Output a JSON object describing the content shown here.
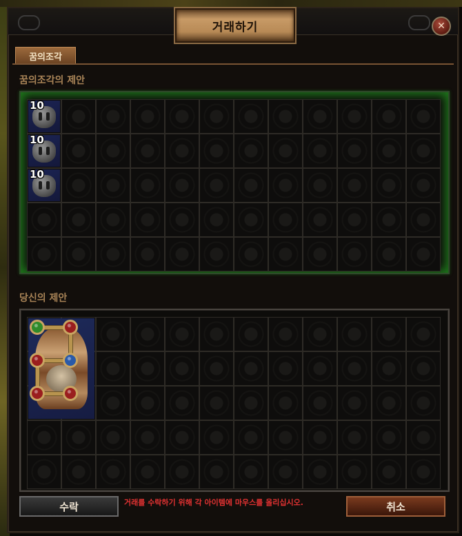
{
  "window": {
    "title": "거래하기",
    "close_glyph": "✕"
  },
  "tabs": [
    {
      "label": "꿈의조각",
      "active": true
    }
  ],
  "their_offer": {
    "label": "꿈의조각의 제안",
    "columns": 12,
    "rows": 5,
    "items": [
      {
        "name": "fragment-item",
        "icon": "stone-face-icon",
        "stack": "10"
      },
      {
        "name": "fragment-item",
        "icon": "stone-face-icon",
        "stack": "10"
      },
      {
        "name": "fragment-item",
        "icon": "stone-face-icon",
        "stack": "10"
      }
    ]
  },
  "your_offer": {
    "label": "당신의 제안",
    "columns": 12,
    "rows": 5,
    "items": [
      {
        "name": "body-armour-item",
        "icon": "body-armour-icon",
        "sockets": [
          "#2f8a2a",
          "#9a1e1e",
          "#9a1e1e",
          "#2a5aa8",
          "#9a1e1e",
          "#9a1e1e"
        ]
      }
    ]
  },
  "buttons": {
    "accept": "수락",
    "cancel": "취소"
  },
  "notice": "거래를 수락하기 위해 각 아이템에 마우스를 올리십시오.",
  "colors": {
    "offer_highlight": "#1f7a1c",
    "notice_text": "#e23232",
    "label_text": "#a98457"
  }
}
